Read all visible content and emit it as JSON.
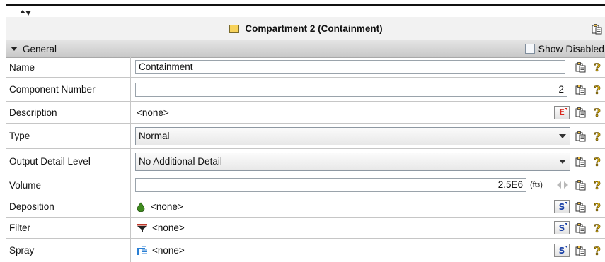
{
  "window": {
    "title": "Compartment 2 (Containment)",
    "title_icon": "folder-icon"
  },
  "section": {
    "label": "General",
    "toggle_icon": "caret-down-icon",
    "show_disabled_label": "Show Disabled",
    "show_disabled_checked": false
  },
  "icons": {
    "copy": "copy-clipboard-icon",
    "help": "help-question-icon",
    "edit": "edit-icon",
    "select": "select-icon"
  },
  "fields": {
    "name": {
      "label": "Name",
      "value": "Containment"
    },
    "component_number": {
      "label": "Component Number",
      "value": "2"
    },
    "description": {
      "label": "Description",
      "value": "<none>",
      "button": "E"
    },
    "type": {
      "label": "Type",
      "selected": "Normal"
    },
    "output_detail_level": {
      "label": "Output Detail Level",
      "selected": "No Additional Detail"
    },
    "volume": {
      "label": "Volume",
      "value": "2.5E6",
      "unit_prefix": "(ft",
      "unit_exp": "3",
      "unit_suffix": ")"
    },
    "deposition": {
      "label": "Deposition",
      "value": "<none>",
      "button": "S",
      "icon": "droplet-icon"
    },
    "filter": {
      "label": "Filter",
      "value": "<none>",
      "button": "S",
      "icon": "filter-funnel-icon"
    },
    "spray": {
      "label": "Spray",
      "value": "<none>",
      "button": "S",
      "icon": "spray-icon"
    }
  },
  "colors": {
    "folder": "#f7d25a",
    "edit_button_text": "#d9261c",
    "select_button_text": "#1d43a8",
    "droplet": "#3f8a1f"
  }
}
